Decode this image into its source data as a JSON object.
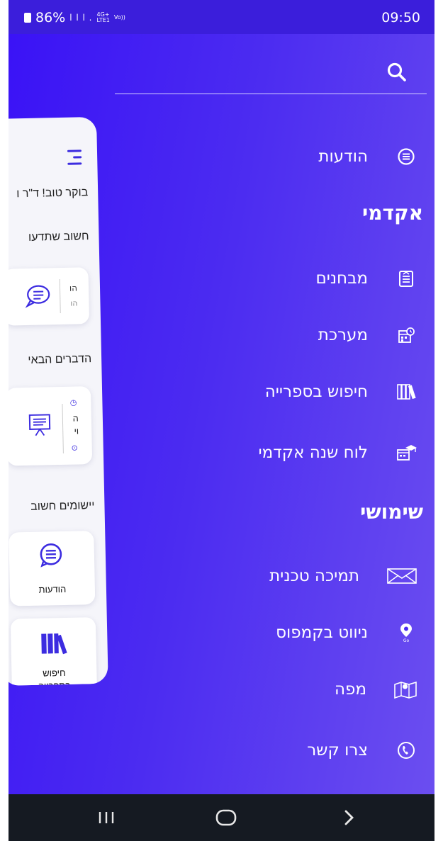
{
  "status_bar": {
    "battery": "86%",
    "signal": "l l l .",
    "network_top": "4G+",
    "network_bottom": "LTE1",
    "volte": "Vo))",
    "time": "09:50"
  },
  "search": {
    "icon": "search-icon"
  },
  "card": {
    "greeting": "בוקר טוב! ד\"ר ו",
    "important_heading": "חשוב שתדעו",
    "tile1_line1": "הו",
    "tile1_line2": "הו",
    "next_heading": "הדברים הבאי",
    "tile2_line1": "ה",
    "tile2_line2": "וי",
    "apps_heading": "יישומים חשוב",
    "app1_label": "הודעות",
    "app2_label": "חיפוש",
    "app2_label_2": "בספרייה"
  },
  "menu": {
    "messages": "הודעות",
    "academic_heading": "אקדמי",
    "exams": "מבחנים",
    "schedule": "מערכת",
    "library_search": "חיפוש בספרייה",
    "academic_calendar": "לוח שנה אקדמי",
    "useful_heading": "שימושי",
    "tech_support": "תמיכה טכנית",
    "campus_navigation": "ניווט בקמפוס",
    "map": "מפה",
    "contact": "צרו קשר"
  },
  "nav_bar": {
    "recents": "recents-icon",
    "home": "home-icon",
    "back": "back-icon"
  },
  "colors": {
    "accent": "#4b2bf1",
    "status_bar": "#3b1edb",
    "nav_bar": "#151a22"
  }
}
